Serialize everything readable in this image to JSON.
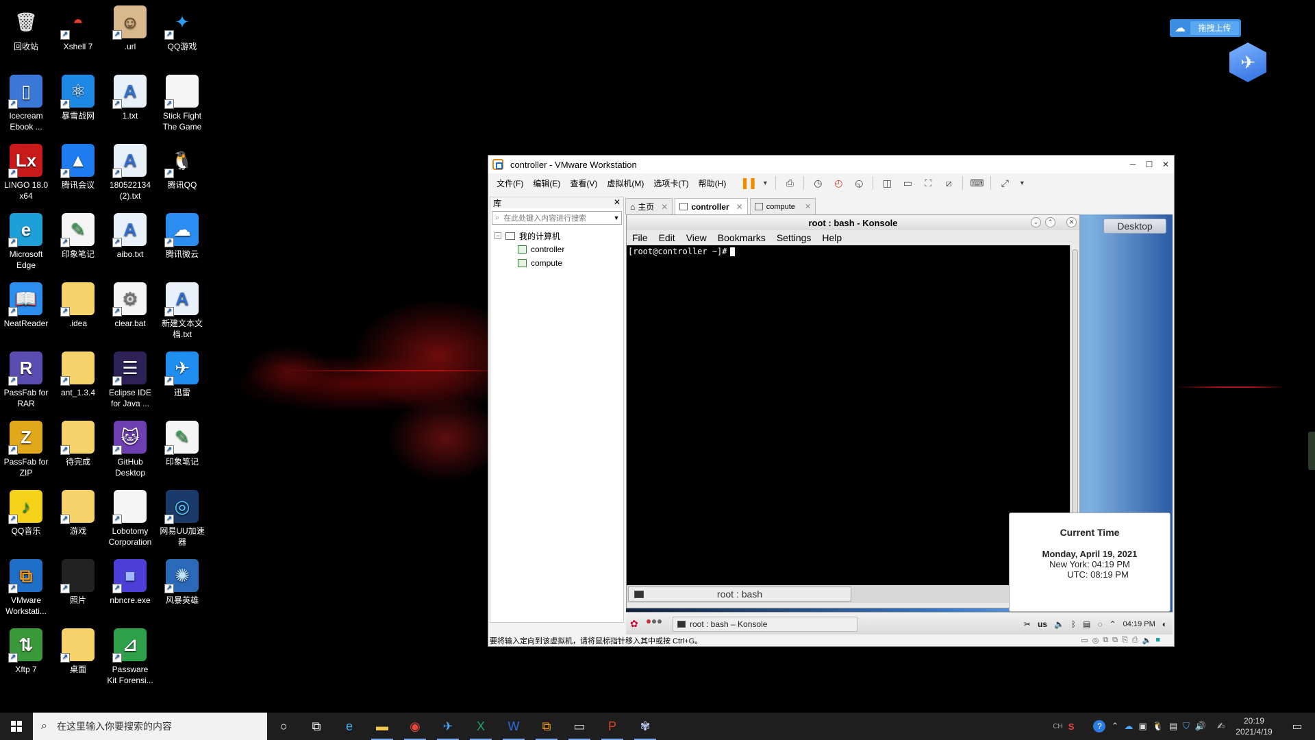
{
  "desktop_icons": [
    {
      "label": "回收站",
      "icon": "recycle-bin-icon",
      "glyph": "🗑",
      "bg": "transparent",
      "fg": "#ddd"
    },
    {
      "label": "Xshell 7",
      "icon": "xshell-icon",
      "glyph": "◓",
      "bg": "transparent",
      "fg": "#e83b2a"
    },
    {
      "label": ".url",
      "icon": "url-file-icon",
      "glyph": "☺",
      "bg": "#d9b98c",
      "fg": "#5a3a1a"
    },
    {
      "label": "QQ游戏",
      "icon": "qq-game-icon",
      "glyph": "✦",
      "bg": "transparent",
      "fg": "#2b9bf0"
    },
    {
      "label": "Icecream\nEbook ...",
      "icon": "icecream-ebook-icon",
      "glyph": "▯",
      "bg": "#3a78d8",
      "fg": "#fff"
    },
    {
      "label": "暴雪战网",
      "icon": "battlenet-icon",
      "glyph": "⚛",
      "bg": "#1e88e5",
      "fg": "#fff"
    },
    {
      "label": "1.txt",
      "icon": "text-file-icon",
      "glyph": "A",
      "bg": "#e8f0fa",
      "fg": "#2f6fd0"
    },
    {
      "label": "Stick Fight\nThe Game",
      "icon": "blank-file-icon",
      "glyph": "",
      "bg": "#f5f5f5",
      "fg": "#999"
    },
    {
      "label": "LINGO 18.0\nx64",
      "icon": "lingo-icon",
      "glyph": "Lx",
      "bg": "#c81a1a",
      "fg": "#fff"
    },
    {
      "label": "腾讯会议",
      "icon": "tencent-meeting-icon",
      "glyph": "▲",
      "bg": "#1e7bf0",
      "fg": "#fff"
    },
    {
      "label": "180522134\n(2).txt",
      "icon": "text-file-icon",
      "glyph": "A",
      "bg": "#e8f0fa",
      "fg": "#2f6fd0"
    },
    {
      "label": "腾讯QQ",
      "icon": "qq-icon",
      "glyph": "🐧",
      "bg": "transparent",
      "fg": "#fff"
    },
    {
      "label": "Microsoft\nEdge",
      "icon": "edge-icon",
      "glyph": "e",
      "bg": "#1d9fd8",
      "fg": "#fff"
    },
    {
      "label": "印象笔记",
      "icon": "evernote-file-icon",
      "glyph": "✎",
      "bg": "#f5f5f5",
      "fg": "#2aa34a"
    },
    {
      "label": "aibo.txt",
      "icon": "text-file-icon",
      "glyph": "A",
      "bg": "#e8f0fa",
      "fg": "#2f6fd0"
    },
    {
      "label": "腾讯微云",
      "icon": "weiyun-icon",
      "glyph": "☁",
      "bg": "#2b8df0",
      "fg": "#fff"
    },
    {
      "label": "NeatReader",
      "icon": "neatreader-icon",
      "glyph": "📖",
      "bg": "#2c8ff0",
      "fg": "#fff"
    },
    {
      "label": ".idea",
      "icon": "folder-icon",
      "glyph": "",
      "bg": "#f6d36a",
      "fg": "#fff"
    },
    {
      "label": "clear.bat",
      "icon": "bat-file-icon",
      "glyph": "⚙",
      "bg": "#f5f5f5",
      "fg": "#777"
    },
    {
      "label": "新建文本文\n档.txt",
      "icon": "text-file-icon",
      "glyph": "A",
      "bg": "#e8f0fa",
      "fg": "#2f6fd0"
    },
    {
      "label": "PassFab for\nRAR",
      "icon": "passfab-rar-icon",
      "glyph": "R",
      "bg": "#5b4db0",
      "fg": "#fff"
    },
    {
      "label": "ant_1.3.4",
      "icon": "folder-icon",
      "glyph": "",
      "bg": "#f6d36a",
      "fg": "#fff"
    },
    {
      "label": "Eclipse IDE\nfor Java ...",
      "icon": "eclipse-icon",
      "glyph": "☰",
      "bg": "#2c2255",
      "fg": "#fff"
    },
    {
      "label": "迅雷",
      "icon": "xunlei-icon",
      "glyph": "✈",
      "bg": "#1f8ef0",
      "fg": "#fff"
    },
    {
      "label": "PassFab for\nZIP",
      "icon": "passfab-zip-icon",
      "glyph": "Z",
      "bg": "#e0a81a",
      "fg": "#fff"
    },
    {
      "label": "待完成",
      "icon": "folder-icon",
      "glyph": "",
      "bg": "#f6d36a",
      "fg": "#fff"
    },
    {
      "label": "GitHub\nDesktop",
      "icon": "github-desktop-icon",
      "glyph": "🐱",
      "bg": "#6e3fb0",
      "fg": "#fff"
    },
    {
      "label": "印象笔记",
      "icon": "evernote-file-icon",
      "glyph": "✎",
      "bg": "#f5f5f5",
      "fg": "#2aa34a"
    },
    {
      "label": "QQ音乐",
      "icon": "qq-music-icon",
      "glyph": "♪",
      "bg": "#f5d21a",
      "fg": "#1a9a3a"
    },
    {
      "label": "游戏",
      "icon": "folder-icon",
      "glyph": "",
      "bg": "#f6d36a",
      "fg": "#fff"
    },
    {
      "label": "Lobotomy\nCorporation",
      "icon": "blank-file-icon",
      "glyph": "",
      "bg": "#f5f5f5",
      "fg": "#999"
    },
    {
      "label": "网易UU加速\n器",
      "icon": "uu-booster-icon",
      "glyph": "◎",
      "bg": "#1a3a6a",
      "fg": "#5fd0ff"
    },
    {
      "label": "VMware\nWorkstati...",
      "icon": "vmware-icon",
      "glyph": "⧉",
      "bg": "#1f6fc9",
      "fg": "#f59a1a"
    },
    {
      "label": "照片",
      "icon": "folder-icon",
      "glyph": "",
      "bg": "#222",
      "fg": "#fff"
    },
    {
      "label": "nbncre.exe",
      "icon": "cube-exe-icon",
      "glyph": "■",
      "bg": "#4c3fd8",
      "fg": "#9fb8ff"
    },
    {
      "label": "风暴英雄",
      "icon": "heroes-storm-icon",
      "glyph": "✺",
      "bg": "#2a68b8",
      "fg": "#bfe6ff"
    },
    {
      "label": "Xftp 7",
      "icon": "xftp-icon",
      "glyph": "⇅",
      "bg": "#3a9a3a",
      "fg": "#fff"
    },
    {
      "label": "桌面",
      "icon": "folder-icon",
      "glyph": "",
      "bg": "#f6d36a",
      "fg": "#fff"
    },
    {
      "label": "Passware\nKit Forensi...",
      "icon": "passware-icon",
      "glyph": "⊿",
      "bg": "#2fa04a",
      "fg": "#fff"
    }
  ],
  "top_widgets": {
    "upload_label": "拖拽上传",
    "cloud_icon": "baidu-cloud-icon",
    "badge_icon": "xunlei-float-icon"
  },
  "vmware": {
    "title": "controller - VMware Workstation",
    "menus": [
      "文件(F)",
      "编辑(E)",
      "查看(V)",
      "虚拟机(M)",
      "选项卡(T)",
      "帮助(H)"
    ],
    "library": {
      "title": "库",
      "search_placeholder": "在此处键入内容进行搜索",
      "root": "我的计算机",
      "vms": [
        "controller",
        "compute"
      ]
    },
    "tabs": [
      {
        "label": "主页",
        "active": false
      },
      {
        "label": "controller",
        "active": true
      },
      {
        "label": "compute",
        "active": false
      }
    ],
    "status_text": "要将输入定向到该虚拟机，请将鼠标指针移入其中或按 Ctrl+G。"
  },
  "konsole": {
    "title": "root : bash - Konsole",
    "menus": [
      "File",
      "Edit",
      "View",
      "Bookmarks",
      "Settings",
      "Help"
    ],
    "prompt": "[root@controller ~]#",
    "tab_label": "root : bash"
  },
  "guest": {
    "desktop_button": "Desktop",
    "clock_popup": {
      "heading": "Current Time",
      "date": "Monday, April 19, 2021",
      "ny": "New York: 04:19 PM",
      "utc": "UTC: 08:19 PM"
    },
    "panel": {
      "task_label": "root : bash – Konsole",
      "keyboard": "us",
      "time": "04:19 PM"
    }
  },
  "taskbar": {
    "search_placeholder": "在这里输入你要搜索的内容",
    "apps": [
      {
        "icon": "cortana-icon",
        "glyph": "○",
        "color": "#fff",
        "running": false
      },
      {
        "icon": "task-view-icon",
        "glyph": "⧉",
        "color": "#fff",
        "running": false
      },
      {
        "icon": "edge-icon",
        "glyph": "e",
        "color": "#3ab0f0",
        "running": false
      },
      {
        "icon": "file-explorer-icon",
        "glyph": "▬",
        "color": "#f2c94c",
        "running": true
      },
      {
        "icon": "chrome-icon",
        "glyph": "◉",
        "color": "#e8453c",
        "running": true
      },
      {
        "icon": "xunlei-icon",
        "glyph": "✈",
        "color": "#4aa3f5",
        "running": true
      },
      {
        "icon": "excel-icon",
        "glyph": "X",
        "color": "#21a366",
        "running": true
      },
      {
        "icon": "word-icon",
        "glyph": "W",
        "color": "#2b6cd8",
        "running": true
      },
      {
        "icon": "vmware-icon",
        "glyph": "⧉",
        "color": "#f59a1a",
        "running": true
      },
      {
        "icon": "terminal-icon",
        "glyph": "▭",
        "color": "#ddd",
        "running": true
      },
      {
        "icon": "powerpoint-icon",
        "glyph": "P",
        "color": "#d24726",
        "running": true
      },
      {
        "icon": "fan-app-icon",
        "glyph": "✾",
        "color": "#b8c8f0",
        "running": true
      }
    ],
    "tray": {
      "ime": "CH",
      "time": "20:19",
      "date": "2021/4/19"
    }
  }
}
